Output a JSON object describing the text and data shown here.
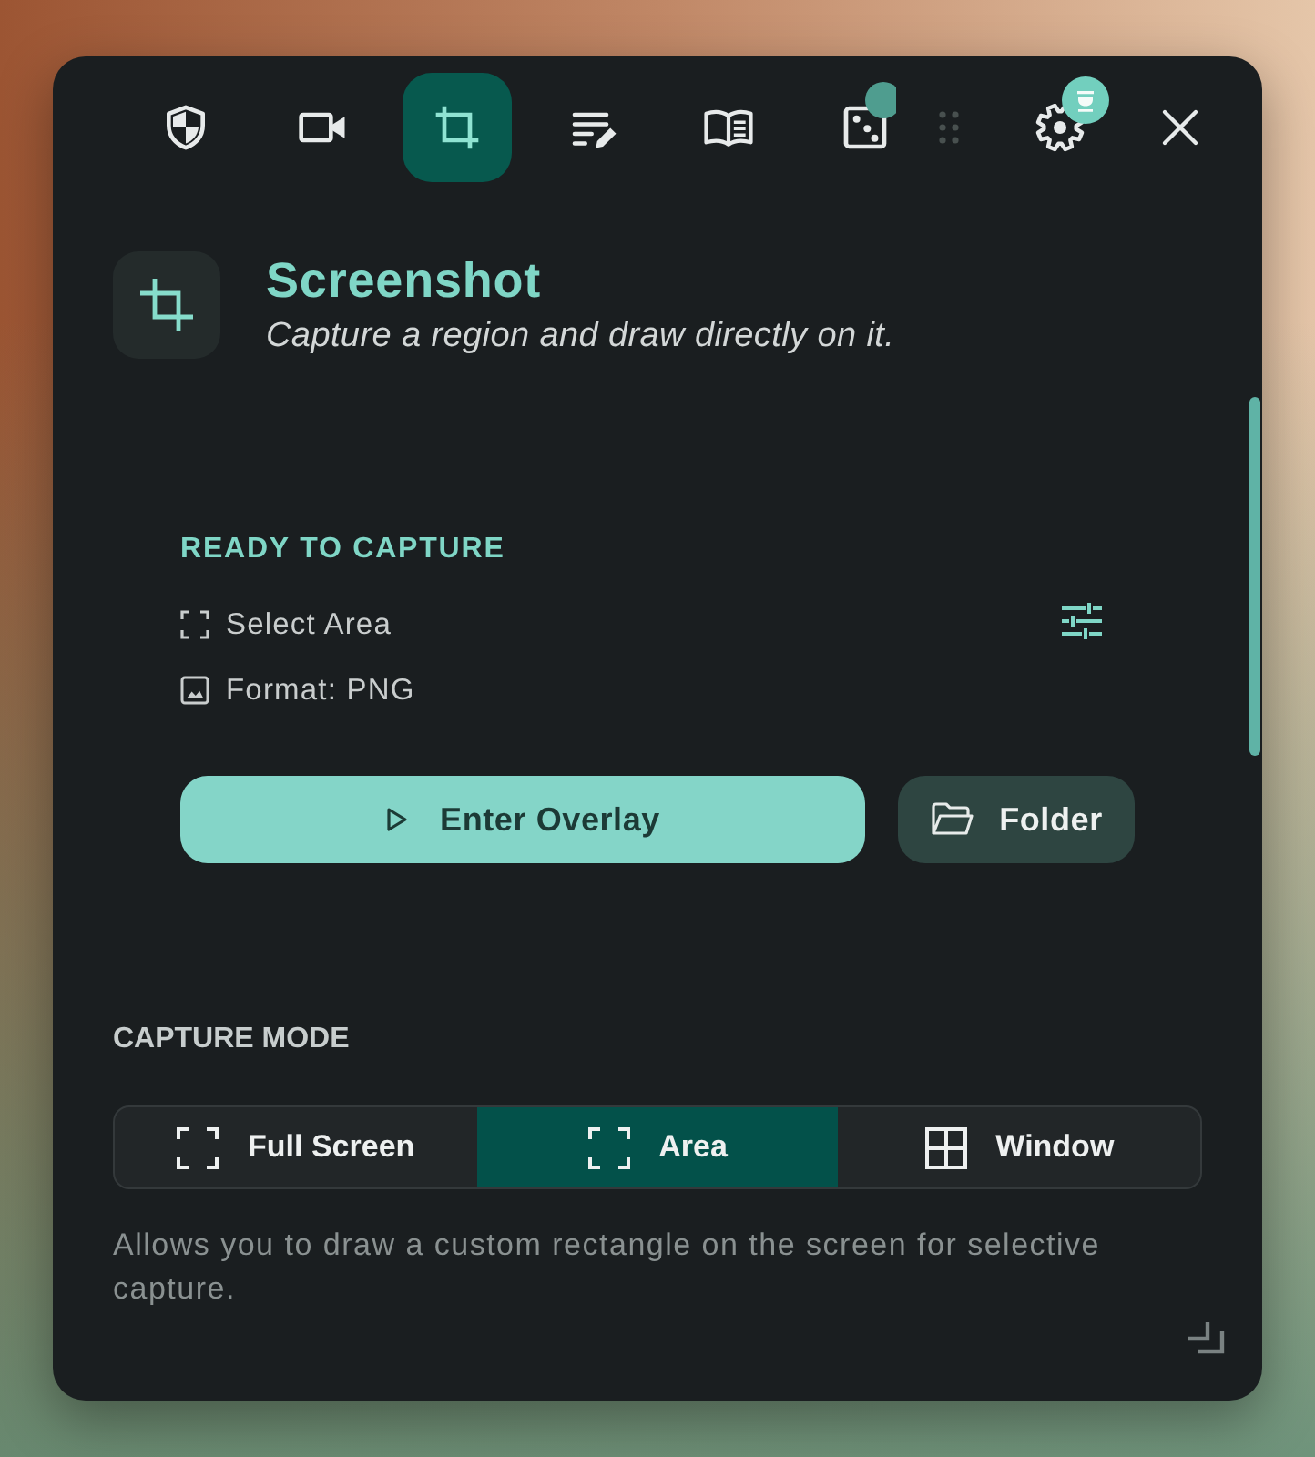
{
  "toolbar": {
    "tabs": [
      {
        "kind": "shield",
        "selected": false,
        "badge": false
      },
      {
        "kind": "video",
        "selected": false,
        "badge": false
      },
      {
        "kind": "crop",
        "selected": true,
        "badge": false
      },
      {
        "kind": "notes",
        "selected": false,
        "badge": false
      },
      {
        "kind": "book",
        "selected": false,
        "badge": false
      },
      {
        "kind": "dice",
        "selected": false,
        "badge": true
      }
    ],
    "settings": {
      "badge": true
    }
  },
  "header": {
    "title": "Screenshot",
    "subtitle": "Capture a region and draw directly on it."
  },
  "status": {
    "heading": "READY TO CAPTURE",
    "details": [
      {
        "kind": "selection",
        "text": "Select Area"
      },
      {
        "kind": "image",
        "text": "Format: PNG"
      }
    ]
  },
  "actions": [
    {
      "kind": "primary",
      "label": "Enter Overlay"
    },
    {
      "kind": "secondary",
      "label": "Folder"
    }
  ],
  "capture_mode": {
    "heading": "CAPTURE MODE",
    "options": [
      {
        "kind": "corners",
        "label": "Full Screen",
        "selected": false
      },
      {
        "kind": "corners",
        "label": "Area",
        "selected": true
      },
      {
        "kind": "grid",
        "label": "Window",
        "selected": false
      }
    ],
    "description": "Allows you to draw a custom rectangle on the screen for selective capture."
  }
}
